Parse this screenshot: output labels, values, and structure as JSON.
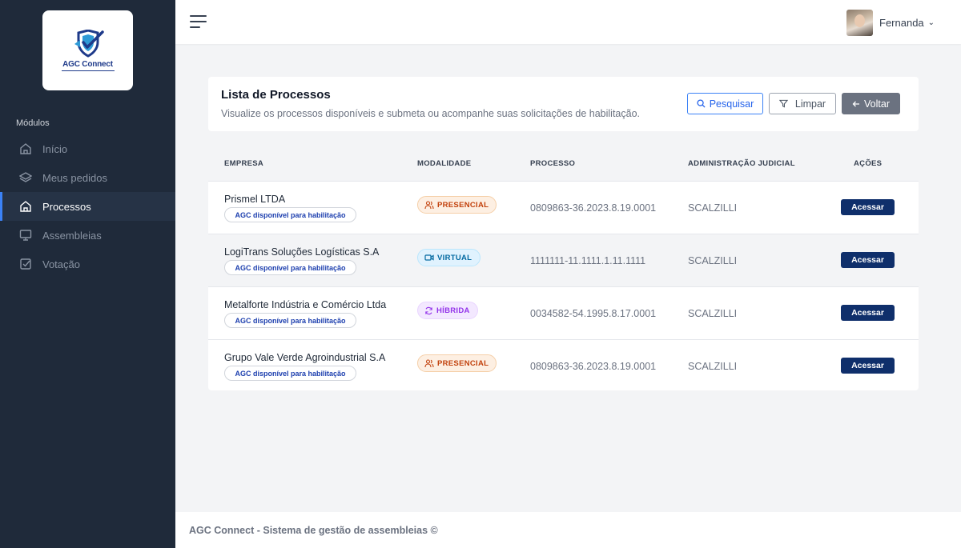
{
  "brand": {
    "logo_text": "AGC Connect"
  },
  "sidebar": {
    "section_label": "Módulos",
    "items": [
      {
        "label": "Início",
        "icon": "home-icon"
      },
      {
        "label": "Meus pedidos",
        "icon": "layers-icon"
      },
      {
        "label": "Processos",
        "icon": "home-icon",
        "active": true
      },
      {
        "label": "Assembleias",
        "icon": "monitor-icon"
      },
      {
        "label": "Votação",
        "icon": "checkbox-icon"
      }
    ]
  },
  "header": {
    "user_name": "Fernanda"
  },
  "page": {
    "title": "Lista de Processos",
    "subtitle": "Visualize os processos disponíveis e submeta ou acompanhe suas solicitações de habilitação.",
    "buttons": {
      "search": "Pesquisar",
      "clear": "Limpar",
      "back": "Voltar"
    }
  },
  "table": {
    "headers": {
      "company": "EMPRESA",
      "modality": "MODALIDADE",
      "process": "PROCESSO",
      "admin": "ADMINISTRAÇÃO JUDICIAL",
      "actions": "AÇÕES"
    },
    "rows": [
      {
        "company": "Prismel LTDA",
        "badge": "AGC disponível para habilitação",
        "modality": "PRESENCIAL",
        "process": "0809863-36.2023.8.19.0001",
        "admin": "SCALZILLI",
        "action": "Acessar"
      },
      {
        "company": "LogiTrans Soluções Logísticas S.A",
        "badge": "AGC disponível para habilitação",
        "modality": "VIRTUAL",
        "process": "1111111-11.1111.1.11.1111",
        "admin": "SCALZILLI",
        "action": "Acessar"
      },
      {
        "company": "Metalforte Indústria e Comércio Ltda",
        "badge": "AGC disponível para habilitação",
        "modality": "HÍBRIDA",
        "process": "0034582-54.1995.8.17.0001",
        "admin": "SCALZILLI",
        "action": "Acessar"
      },
      {
        "company": "Grupo Vale Verde Agroindustrial S.A",
        "badge": "AGC disponível para habilitação",
        "modality": "PRESENCIAL",
        "process": "0809863-36.2023.8.19.0001",
        "admin": "SCALZILLI",
        "action": "Acessar"
      }
    ]
  },
  "footer": {
    "text": "AGC Connect - Sistema de gestão de assembleias ©"
  },
  "colors": {
    "sidebar_bg": "#1f2a3a",
    "accent": "#3b82f6",
    "primary_button": "#0f2f6b",
    "presencial": "#c2410c",
    "virtual": "#0369a1",
    "hibrida": "#9333ea"
  }
}
